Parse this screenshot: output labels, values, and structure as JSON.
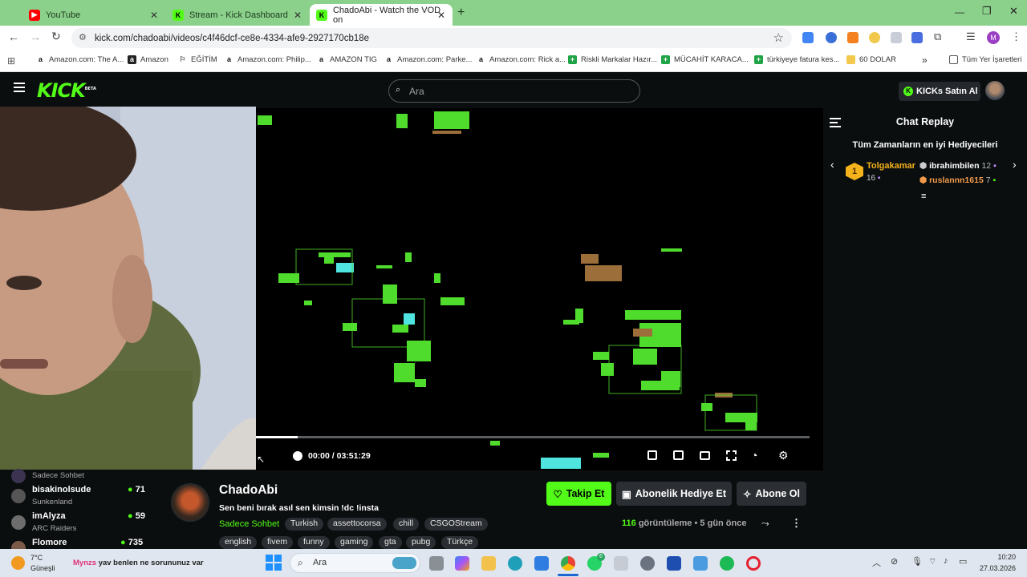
{
  "browser": {
    "tabs": [
      {
        "title": "YouTube",
        "active": false
      },
      {
        "title": "Stream - Kick Dashboard",
        "active": false
      },
      {
        "title": "ChadoAbi - Watch the VOD on",
        "active": true
      }
    ],
    "new_tab": "+",
    "url": "kick.com/chadoabi/videos/c4f46dcf-ce8e-4334-afe9-2927170cb18e",
    "bookmarks": [
      "Amazon.com: The A...",
      "Amazon",
      "EĞİTİM",
      "Amazon.com: Philip...",
      "AMAZON TIG",
      "Amazon.com: Parke...",
      "Amazon.com: Rick a...",
      "Riskli Markalar Hazır...",
      "MÜCAHİT KARACA...",
      "türkiyeye fatura kes...",
      "60 DOLAR"
    ],
    "all_bookmarks": "Tüm Yer İşaretleri",
    "profile_initial": "M",
    "more_bookmarks": "»"
  },
  "kick": {
    "logo": "KICK",
    "logo_badge": "BETA",
    "search_placeholder": "Ara",
    "kicks_button": "KICKs Satın Al"
  },
  "player": {
    "time_current": "00:00",
    "time_separator": "/",
    "time_total": "03:51:29"
  },
  "chat": {
    "title": "Chat Replay",
    "gifters_title": "Tüm Zamanların en iyi Hediyecileri",
    "top_gifter": {
      "rank": "1",
      "name": "Tolgakamar",
      "count": "16"
    },
    "gifters": [
      {
        "name": "ibrahimbilen",
        "count": "12"
      },
      {
        "name": "ruslannn1615",
        "count": "7"
      }
    ]
  },
  "sidebar_channels": [
    {
      "name": "",
      "category": "Sadece Sohbet",
      "viewers": ""
    },
    {
      "name": "bisakinolsude",
      "category": "Sunkenland",
      "viewers": "71"
    },
    {
      "name": "imAlyza",
      "category": "ARC Raiders",
      "viewers": "59"
    },
    {
      "name": "Flomore",
      "category": "",
      "viewers": "735"
    }
  ],
  "channel": {
    "name": "ChadoAbi",
    "title": "Sen beni bırak asıl sen kimsin !dc !insta",
    "category": "Sadece Sohbet",
    "tags_row1": [
      "Turkish",
      "assettocorsa",
      "chill",
      "CSGOStream"
    ],
    "tags_row2": [
      "english",
      "fivem",
      "funny",
      "gaming",
      "gta",
      "pubg",
      "Türkçe"
    ],
    "follow": "Takip Et",
    "gift_sub": "Abonelik Hediye Et",
    "subscribe": "Abone Ol",
    "views_count": "116",
    "views_label": "görüntüleme",
    "dot": "•",
    "ago": "5 gün önce"
  },
  "taskbar": {
    "weather_temp": "7°C",
    "weather_desc": "Güneşli",
    "notif_user": "Mynzs",
    "notif_text": "yav benlen ne sorununuz var",
    "search": "Ara",
    "time": "10:20",
    "date": "27.03.2026",
    "whatsapp_badge": "6"
  },
  "colors": {
    "kick_green": "#53fc18",
    "tab_bar": "#8bd08b",
    "gold": "#f5b31b",
    "orange": "#f29a4a"
  }
}
